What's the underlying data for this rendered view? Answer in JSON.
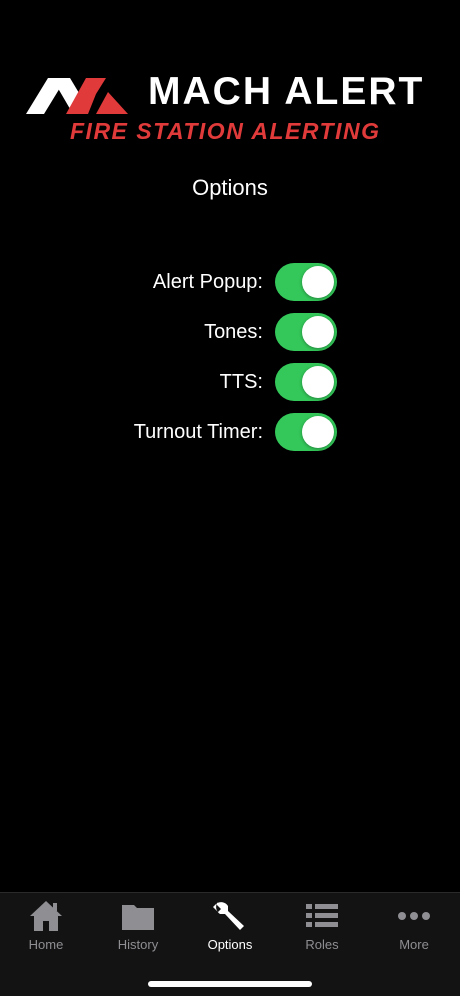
{
  "brand": {
    "name": "MACH ALERT",
    "tagline": "FIRE STATION ALERTING",
    "accent_color": "#e03a3a"
  },
  "page": {
    "title": "Options"
  },
  "options": [
    {
      "label": "Alert Popup:",
      "enabled": true
    },
    {
      "label": "Tones:",
      "enabled": true
    },
    {
      "label": "TTS:",
      "enabled": true
    },
    {
      "label": "Turnout Timer:",
      "enabled": true
    }
  ],
  "toggle_on_color": "#34c759",
  "tabs": [
    {
      "label": "Home",
      "icon": "home-icon",
      "active": false
    },
    {
      "label": "History",
      "icon": "folder-icon",
      "active": false
    },
    {
      "label": "Options",
      "icon": "wrench-icon",
      "active": true
    },
    {
      "label": "Roles",
      "icon": "list-icon",
      "active": false
    },
    {
      "label": "More",
      "icon": "more-dots-icon",
      "active": false
    }
  ]
}
